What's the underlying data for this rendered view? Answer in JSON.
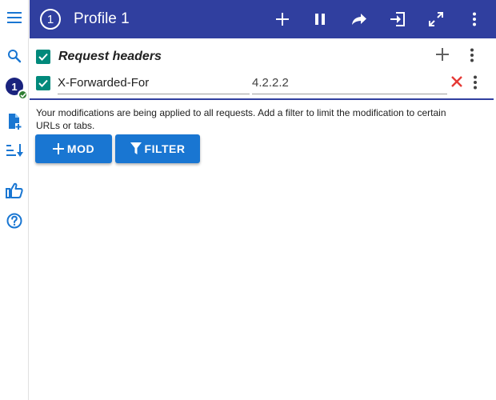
{
  "header": {
    "profile_number": "1",
    "profile_title": "Profile 1",
    "icons": [
      "add-icon",
      "pause-icon",
      "share-icon",
      "import-icon",
      "expand-icon",
      "more-icon"
    ]
  },
  "sidebar": {
    "items": [
      {
        "icon": "menu-icon"
      },
      {
        "icon": "search-icon"
      },
      {
        "icon": "profile-icon",
        "label": "1",
        "active": true
      },
      {
        "icon": "add-file-icon"
      },
      {
        "icon": "sort-icon"
      },
      {
        "icon": "thumb-up-icon"
      },
      {
        "icon": "help-icon"
      }
    ]
  },
  "section": {
    "title": "Request headers",
    "checked": true,
    "rows": [
      {
        "checked": true,
        "name": "X-Forwarded-For",
        "value": "4.2.2.2"
      }
    ],
    "info": "Your modifications are being applied to all requests. Add a filter to limit the modification to certain URLs or tabs."
  },
  "buttons": {
    "mod_label": "MOD",
    "filter_label": "FILTER"
  },
  "colors": {
    "topbar": "#303f9f",
    "checkbox": "#00897b",
    "button": "#1976d2",
    "delete": "#e53935",
    "badge": "#2e7d32"
  }
}
